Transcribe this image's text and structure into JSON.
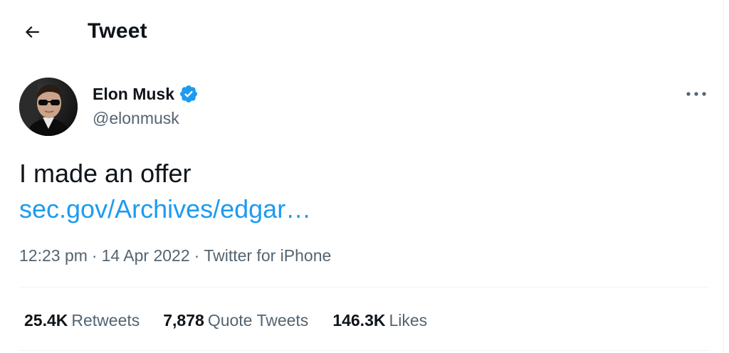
{
  "header": {
    "back_icon": "arrow-left-icon",
    "title": "Tweet"
  },
  "author": {
    "name": "Elon Musk",
    "handle": "@elonmusk",
    "verified_icon": "verified-badge-icon",
    "verified_color": "#1d9bf0"
  },
  "more_icon": "more-horizontal-icon",
  "tweet": {
    "text": "I made an offer",
    "link": "sec.gov/Archives/edgar…"
  },
  "meta": {
    "time": "12:23 pm",
    "separator": "·",
    "date": "14 Apr 2022",
    "source": "Twitter for iPhone"
  },
  "stats": {
    "retweets": {
      "count": "25.4K",
      "label": "Retweets"
    },
    "quotes": {
      "count": "7,878",
      "label": "Quote Tweets"
    },
    "likes": {
      "count": "146.3K",
      "label": "Likes"
    }
  },
  "colors": {
    "text": "#0f1419",
    "secondary": "#536471",
    "link": "#1d9bf0",
    "divider": "#eff3f4"
  }
}
